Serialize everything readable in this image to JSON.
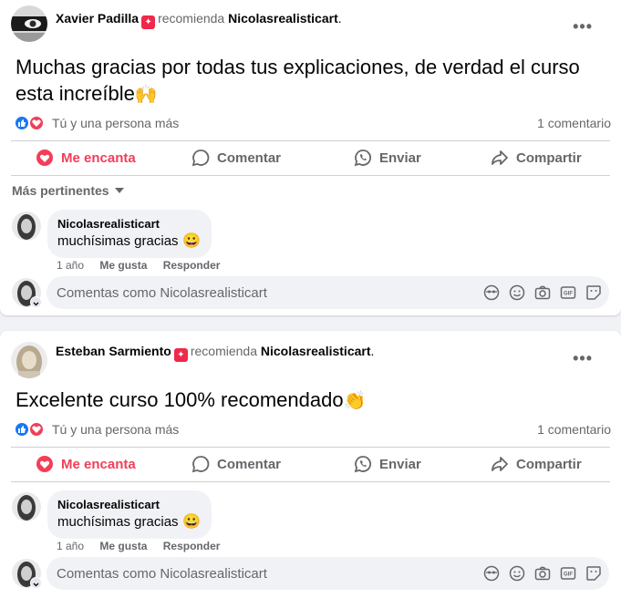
{
  "posts": [
    {
      "author": "Xavier Padilla",
      "recommends_text": "recomienda",
      "page": "Nicolasrealisticart",
      "period": ".",
      "text": "Muchas gracias por todas tus explicaciones, de verdad el curso esta increíble",
      "text_emoji": "🙌",
      "reaction_text": "Tú y una persona más",
      "comment_count": "1 comentario",
      "actions": {
        "love": "Me encanta",
        "comment": "Comentar",
        "send": "Enviar",
        "share": "Compartir"
      },
      "sort_label": "Más pertinentes",
      "comment": {
        "author": "Nicolasrealisticart",
        "text": "muchísimas gracias",
        "emoji": "😀",
        "time": "1 año",
        "like": "Me gusta",
        "reply": "Responder"
      },
      "composer_placeholder": "Comentas como Nicolasrealisticart"
    },
    {
      "author": "Esteban Sarmiento",
      "recommends_text": "recomienda",
      "page": "Nicolasrealisticart",
      "period": ".",
      "text": "Excelente curso 100% recomendado",
      "text_emoji": "👏",
      "reaction_text": "Tú y una persona más",
      "comment_count": "1 comentario",
      "actions": {
        "love": "Me encanta",
        "comment": "Comentar",
        "send": "Enviar",
        "share": "Compartir"
      },
      "comment": {
        "author": "Nicolasrealisticart",
        "text": "muchísimas gracias",
        "emoji": "😀",
        "time": "1 año",
        "like": "Me gusta",
        "reply": "Responder"
      },
      "composer_placeholder": "Comentas como Nicolasrealisticart"
    }
  ],
  "more_glyph": "•••",
  "colors": {
    "love": "#f33e58",
    "like": "#1877f2",
    "muted": "#65676b",
    "badge": "#f02849"
  }
}
